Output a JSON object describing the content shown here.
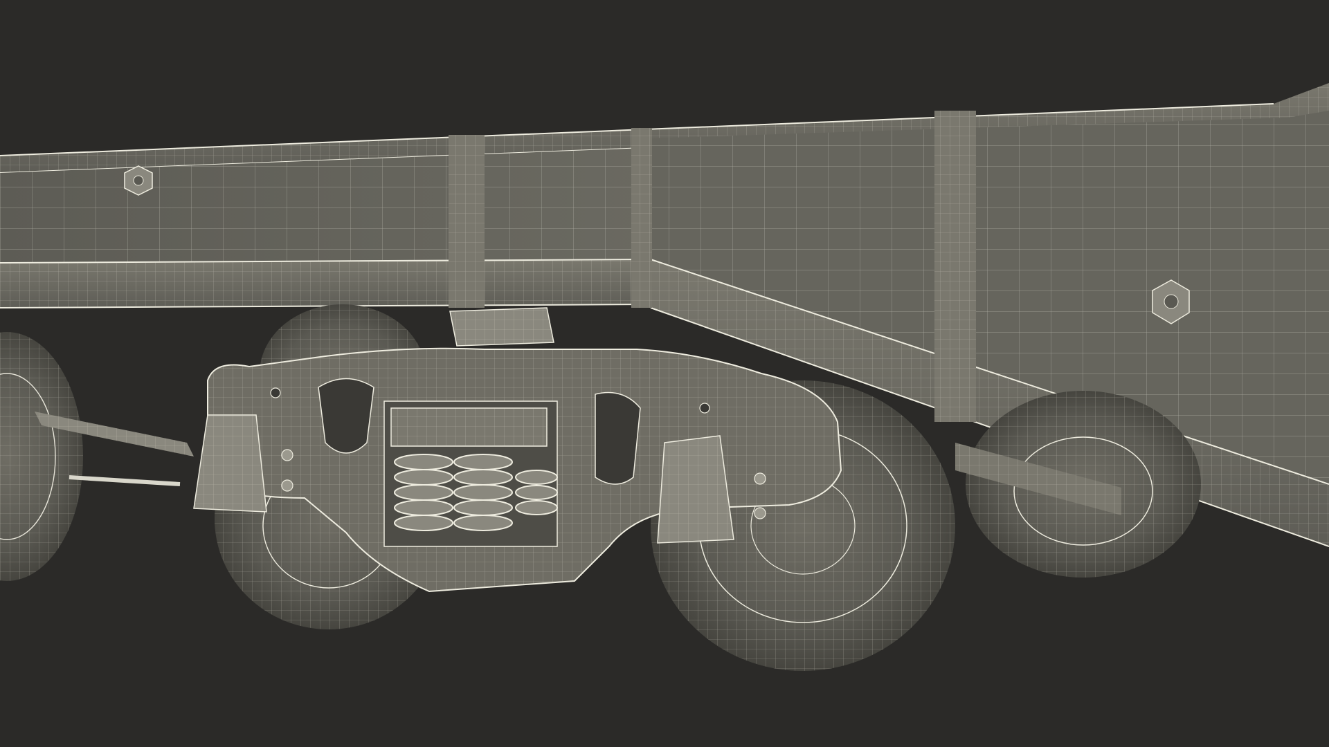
{
  "scene": {
    "subject": "railcar-bogie-wireframe-render",
    "background_color": "#2b2a28",
    "surface_color": "#6e6c62",
    "wire_color": "#e8e6da",
    "shadow_color": "#4a4944"
  }
}
